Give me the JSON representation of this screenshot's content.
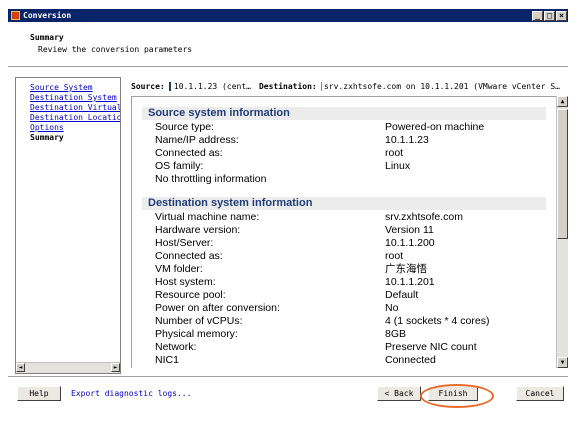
{
  "window": {
    "title": "Conversion",
    "min_label": "_",
    "max_label": "□",
    "close_label": "×"
  },
  "header": {
    "title": "Summary",
    "subtitle": "Review the conversion parameters"
  },
  "nav": {
    "items": [
      {
        "label": "Source System",
        "state": "link"
      },
      {
        "label": "Destination System",
        "state": "link"
      },
      {
        "label": "Destination Virtual M",
        "state": "link"
      },
      {
        "label": "Destination Location",
        "state": "link"
      },
      {
        "label": "Options",
        "state": "link"
      },
      {
        "label": "Summary",
        "state": "current"
      }
    ]
  },
  "source_bar": {
    "source_label": "Source:",
    "source_value": "10.1.1.23 (cent…",
    "dest_label": "Destination:",
    "dest_value": "srv.zxhtsofe.com on 10.1.1.201 (VMware vCenter S…"
  },
  "source_section": {
    "title": "Source system information",
    "rows": [
      {
        "label": "Source type:",
        "value": "Powered-on machine"
      },
      {
        "label": "Name/IP address:",
        "value": "10.1.1.23"
      },
      {
        "label": "Connected as:",
        "value": "root"
      },
      {
        "label": "OS family:",
        "value": "Linux"
      },
      {
        "label": "No throttling information",
        "value": ""
      }
    ]
  },
  "dest_section": {
    "title": "Destination system information",
    "rows": [
      {
        "label": "Virtual machine name:",
        "value": "srv.zxhtsofe.com"
      },
      {
        "label": "Hardware version:",
        "value": "Version 11"
      },
      {
        "label": "Host/Server:",
        "value": "10.1.1.200"
      },
      {
        "label": "Connected as:",
        "value": "root"
      },
      {
        "label": "VM folder:",
        "value": "广东海悟"
      },
      {
        "label": "Host system:",
        "value": "10.1.1.201"
      },
      {
        "label": "Resource pool:",
        "value": "Default"
      },
      {
        "label": "Power on after conversion:",
        "value": "No"
      },
      {
        "label": "Number of vCPUs:",
        "value": "4 (1 sockets * 4 cores)"
      },
      {
        "label": "Physical memory:",
        "value": "8GB"
      },
      {
        "label": "Network:",
        "value": "Preserve NIC count"
      },
      {
        "label": "NIC1",
        "value": "Connected"
      }
    ]
  },
  "footer": {
    "help_label": "Help",
    "export_label": "Export diagnostic logs...",
    "back_label": "< Back",
    "finish_label": "Finish",
    "cancel_label": "Cancel"
  },
  "colors": {
    "titlebar": "#0a246a",
    "section_text": "#1f3d7a",
    "link": "#0000cc",
    "highlight_ring": "#e86a2a"
  }
}
